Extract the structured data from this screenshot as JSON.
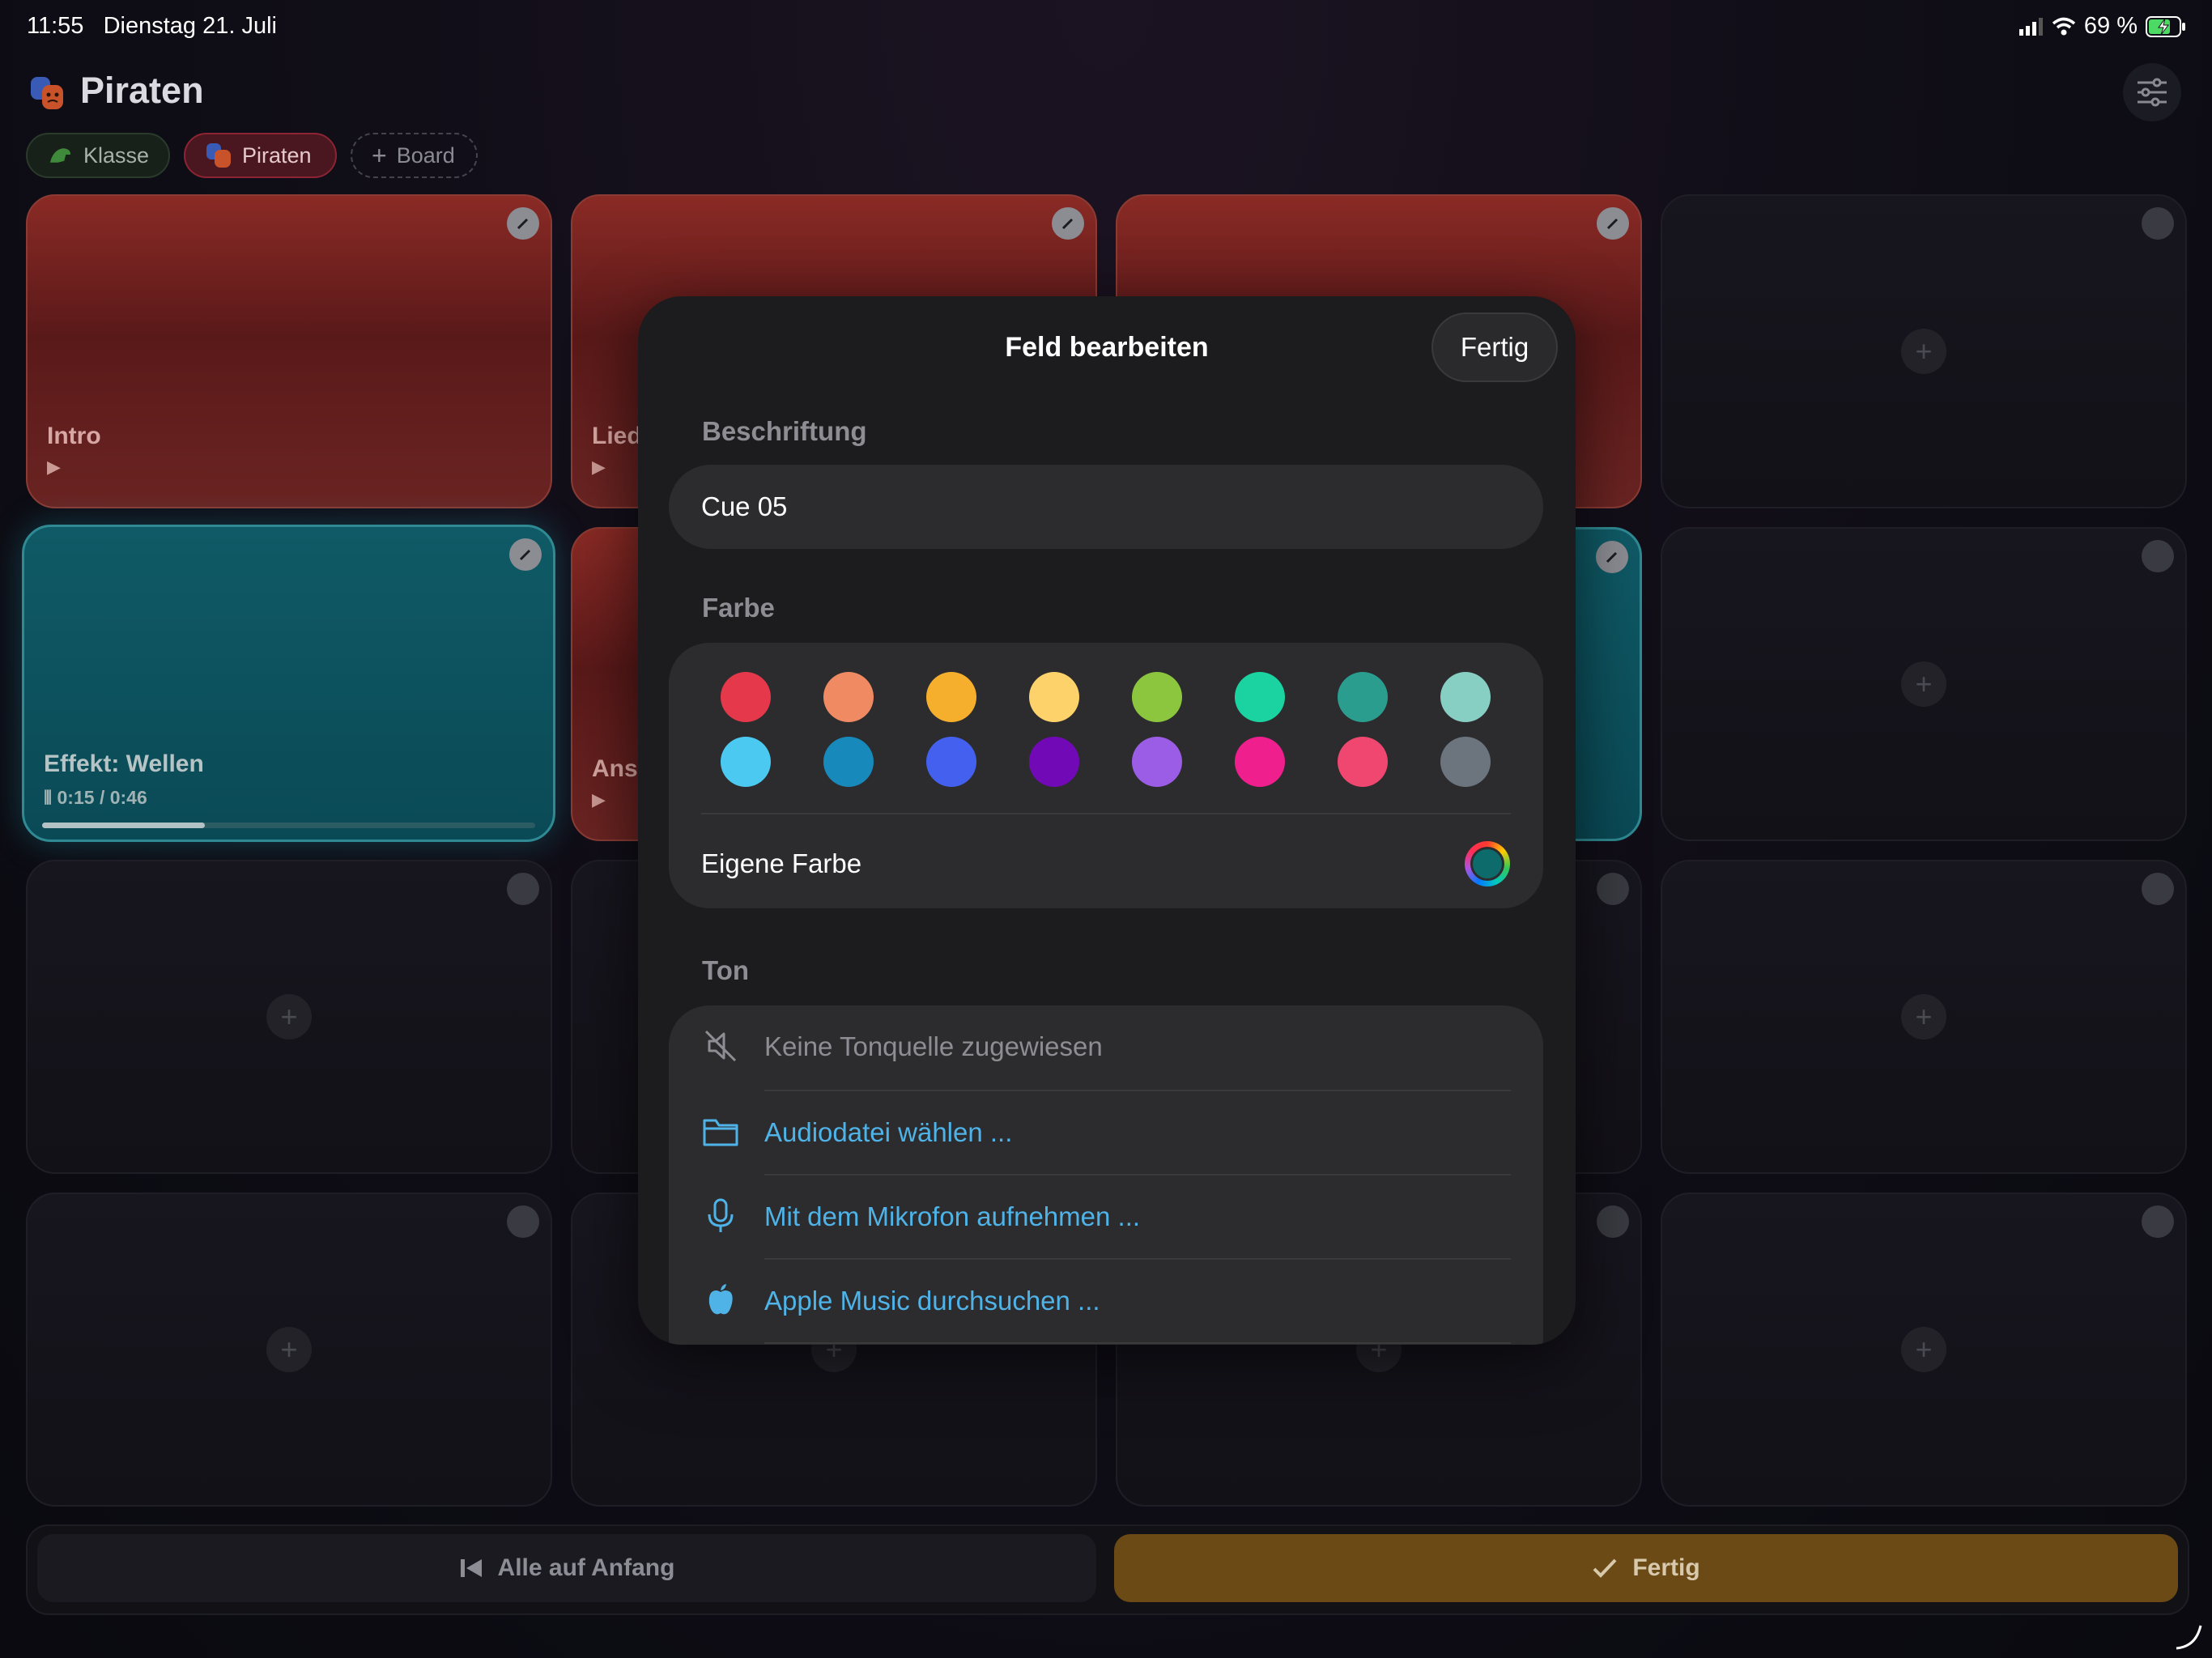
{
  "status_bar": {
    "time": "11:55",
    "date": "Dienstag 21. Juli",
    "battery": "69 %"
  },
  "header": {
    "title": "Piraten",
    "boards": [
      {
        "label": "Klasse"
      },
      {
        "label": "Piraten"
      },
      {
        "label": "Board"
      }
    ]
  },
  "tiles": {
    "intro_label": "Intro",
    "lied_label": "Lied",
    "wellen_label": "Effekt: Wellen",
    "wellen_time": "0:15 / 0:46",
    "wellen_progress": 0.33,
    "ans_label": "Ans",
    "play_glyph": "▶"
  },
  "bottom_bar": {
    "reset_label": "Alle auf Anfang",
    "done_label": "Fertig"
  },
  "modal": {
    "title": "Feld bearbeiten",
    "done_label": "Fertig",
    "caption_section": "Beschriftung",
    "caption_value": "Cue 05",
    "color_section": "Farbe",
    "colors_row1": [
      "#e5384a",
      "#f08a63",
      "#f6ae2d",
      "#fed26a",
      "#8cc63f",
      "#1ad3a0",
      "#2a9d8f",
      "#88cfc3"
    ],
    "colors_row2": [
      "#4cc9f0",
      "#1789bb",
      "#4361ee",
      "#7209b7",
      "#9b5de5",
      "#f01f8e",
      "#ef476f",
      "#6c757d"
    ],
    "custom_color_label": "Eigene Farbe",
    "custom_color_value": "#0d6b6b",
    "sound_section": "Ton",
    "sound_rows": [
      {
        "label": "Keine Tonquelle zugewiesen",
        "icon": "speaker-muted-icon"
      },
      {
        "label": "Audiodatei wählen ...",
        "icon": "folder-icon"
      },
      {
        "label": "Mit dem Mikrofon aufnehmen ...",
        "icon": "microphone-icon"
      },
      {
        "label": "Apple Music durchsuchen ...",
        "icon": "apple-icon"
      }
    ],
    "accent_color": "#4fb3e8"
  }
}
